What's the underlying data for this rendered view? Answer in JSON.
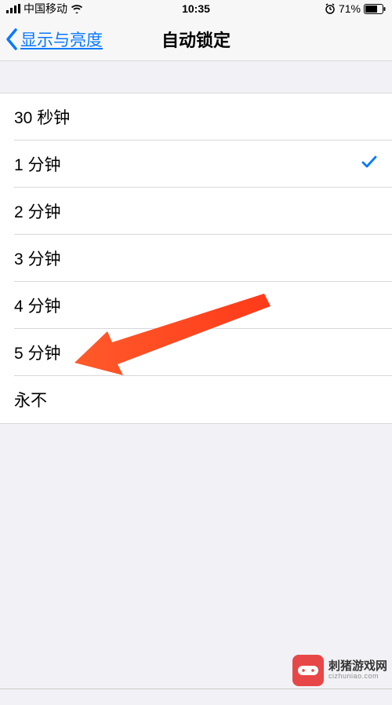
{
  "status": {
    "carrier": "中国移动",
    "time": "10:35",
    "battery_pct": "71%"
  },
  "nav": {
    "back_label": "显示与亮度",
    "title": "自动锁定"
  },
  "options": [
    {
      "label": "30 秒钟",
      "selected": false
    },
    {
      "label": "1 分钟",
      "selected": true
    },
    {
      "label": "2 分钟",
      "selected": false
    },
    {
      "label": "3 分钟",
      "selected": false
    },
    {
      "label": "4 分钟",
      "selected": false
    },
    {
      "label": "5 分钟",
      "selected": false
    },
    {
      "label": "永不",
      "selected": false
    }
  ],
  "watermark": {
    "main": "刺猪游戏网",
    "sub": "cizhuniao.com"
  }
}
